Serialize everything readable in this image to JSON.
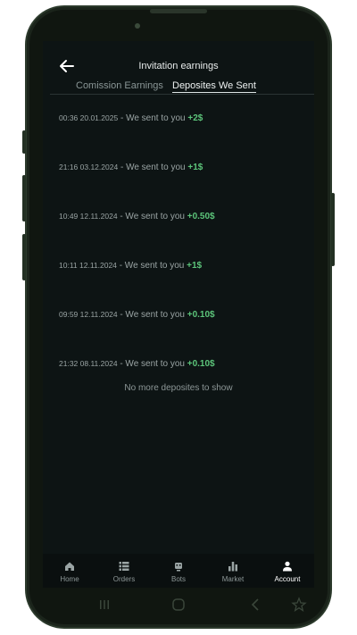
{
  "header": {
    "title": "Invitation earnings"
  },
  "tabs": [
    {
      "label": "Comission Earnings",
      "active": false
    },
    {
      "label": "Deposites We Sent",
      "active": true
    }
  ],
  "deposits": [
    {
      "datetime": "00:36 20.01.2025",
      "text": " - We sent to you ",
      "amount": "+2$"
    },
    {
      "datetime": "21:16 03.12.2024",
      "text": " - We sent to you ",
      "amount": "+1$"
    },
    {
      "datetime": "10:49 12.11.2024",
      "text": " - We sent to you ",
      "amount": "+0.50$"
    },
    {
      "datetime": "10:11 12.11.2024",
      "text": " - We sent to you ",
      "amount": "+1$"
    },
    {
      "datetime": "09:59 12.11.2024",
      "text": " - We sent to you ",
      "amount": "+0.10$"
    },
    {
      "datetime": "21:32 08.11.2024",
      "text": " - We sent to you ",
      "amount": "+0.10$"
    }
  ],
  "empty_message": "No more deposites to show",
  "bottom_nav": [
    {
      "label": "Home",
      "icon": "home-icon",
      "active": false
    },
    {
      "label": "Orders",
      "icon": "list-icon",
      "active": false
    },
    {
      "label": "Bots",
      "icon": "robot-icon",
      "active": false
    },
    {
      "label": "Market",
      "icon": "bar-chart-icon",
      "active": false
    },
    {
      "label": "Account",
      "icon": "user-icon",
      "active": true
    }
  ],
  "colors": {
    "background": "#0d1414",
    "amount": "#5cc47a",
    "muted_text": "#9aa4a4"
  }
}
